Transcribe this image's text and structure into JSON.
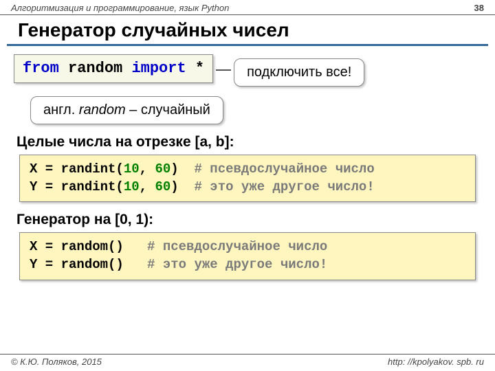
{
  "header": {
    "course": "Алгоритмизация и программирование, язык Python",
    "page": "38"
  },
  "title": "Генератор случайных чисел",
  "import_line": {
    "kw_from": "from",
    "mod": " random ",
    "kw_import": "import",
    "star": " *"
  },
  "callout_right": "подключить все!",
  "callout_below_prefix": "англ. ",
  "callout_below_word": "random",
  "callout_below_suffix": " – случайный",
  "section1": "Целые числа на отрезке [a, b]:",
  "code1": {
    "l1a": "X = randint(",
    "l1n1": "10",
    "l1b": ", ",
    "l1n2": "60",
    "l1c": ")  ",
    "l1cm": "# псевдослучайное число",
    "l2a": "Y = randint(",
    "l2n1": "10",
    "l2b": ", ",
    "l2n2": "60",
    "l2c": ")  ",
    "l2cm": "# это уже другое число!"
  },
  "section2": "Генератор на [0, 1):",
  "code2": {
    "l1a": "X = random()   ",
    "l1cm": "# псевдослучайное число",
    "l2a": "Y = random()   ",
    "l2cm": "# это уже другое число!"
  },
  "footer": {
    "left": "© К.Ю. Поляков, 2015",
    "right": "http: //kpolyakov. spb. ru"
  }
}
